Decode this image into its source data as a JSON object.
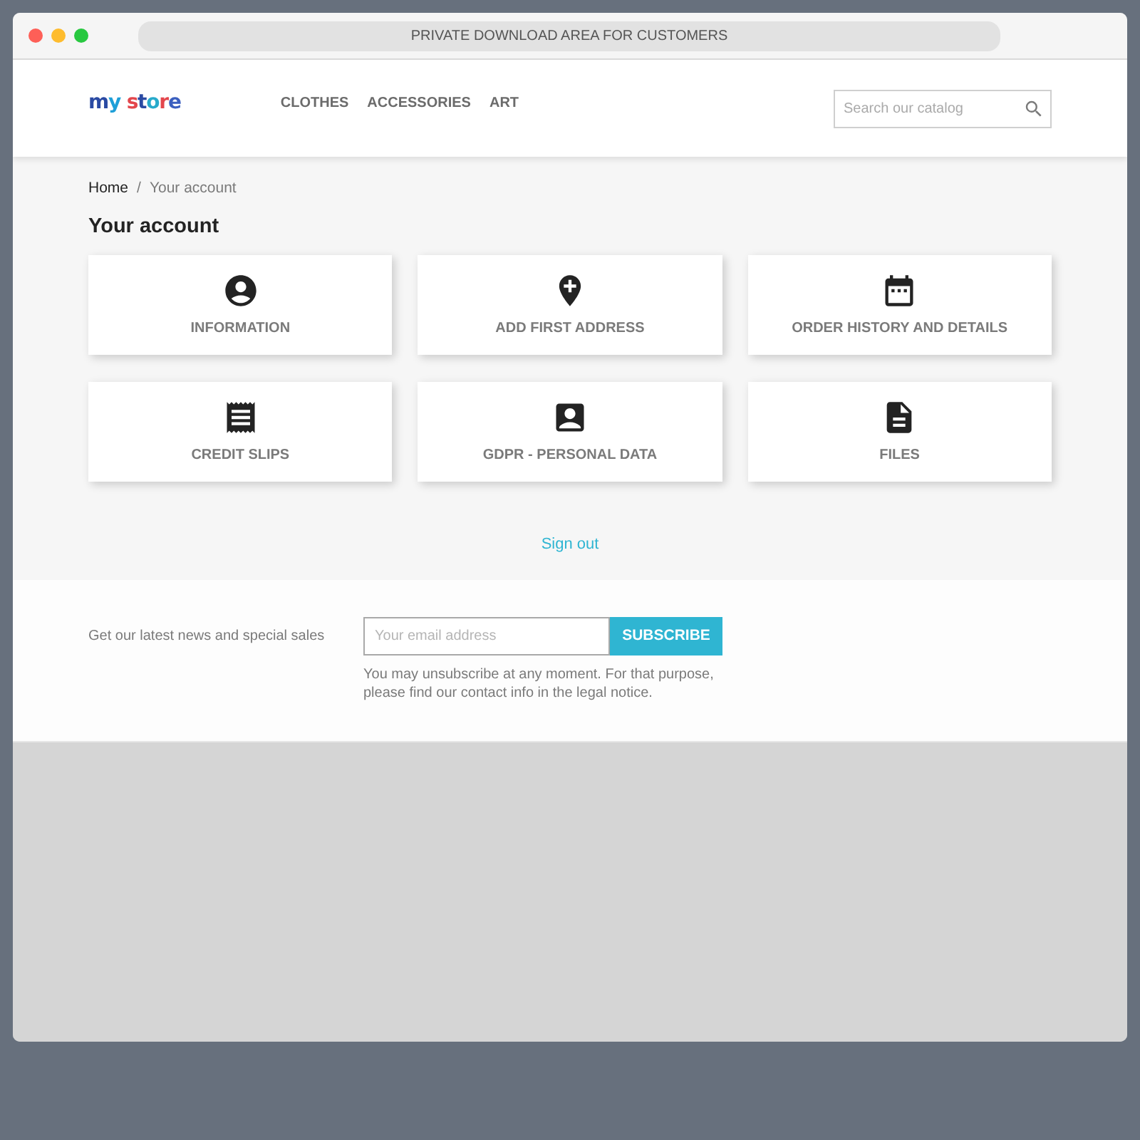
{
  "window": {
    "title": "PRIVATE DOWNLOAD AREA FOR CUSTOMERS"
  },
  "header": {
    "logo": "my store",
    "nav": [
      "CLOTHES",
      "ACCESSORIES",
      "ART"
    ],
    "search": {
      "placeholder": "Search our catalog"
    }
  },
  "breadcrumb": {
    "items": [
      "Home",
      "Your account"
    ],
    "separator": "/"
  },
  "page_title": "Your account",
  "account_links": [
    {
      "label": "INFORMATION"
    },
    {
      "label": "ADD FIRST ADDRESS"
    },
    {
      "label": "ORDER HISTORY AND DETAILS"
    },
    {
      "label": "CREDIT SLIPS"
    },
    {
      "label": "GDPR - PERSONAL DATA"
    },
    {
      "label": "FILES"
    }
  ],
  "sign_out": "Sign out",
  "newsletter": {
    "label": "Get our latest news and special sales",
    "email": {
      "placeholder": "Your email address"
    },
    "button": "SUBSCRIBE",
    "note": "You may unsubscribe at any moment. For that purpose, please find our contact info in the legal notice."
  }
}
